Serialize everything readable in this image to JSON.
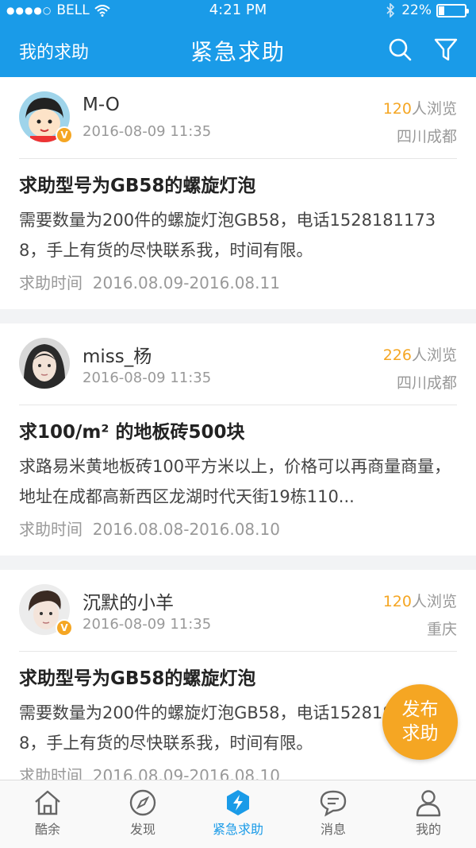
{
  "status": {
    "signal_dots": "●●●●○",
    "carrier": "BELL",
    "time": "4:21 PM",
    "battery": "22%"
  },
  "nav": {
    "left_label": "我的求助",
    "title": "紧急求助",
    "search_icon": "search-icon",
    "filter_icon": "filter-icon"
  },
  "posts": [
    {
      "user": "M-O",
      "time": "2016-08-09  11:35",
      "views_count": "120",
      "views_suffix": "人浏览",
      "location": "四川成都",
      "verified": "V",
      "title": "求助型号为GB58的螺旋灯泡",
      "desc": "需要数量为200件的螺旋灯泡GB58，电话15281811738，手上有货的尽快联系我，时间有限。",
      "help_time_label": "求助时间",
      "help_time": "2016.08.09-2016.08.11"
    },
    {
      "user": "miss_杨",
      "time": "2016-08-09  11:35",
      "views_count": "226",
      "views_suffix": "人浏览",
      "location": "四川成都",
      "verified": "",
      "title": "求100/m² 的地板砖500块",
      "desc": "求路易米黄地板砖100平方米以上，价格可以再商量商量，地址在成都高新西区龙湖时代天街19栋110...",
      "help_time_label": "求助时间",
      "help_time": "2016.08.08-2016.08.10"
    },
    {
      "user": "沉默的小羊",
      "time": "2016-08-09  11:35",
      "views_count": "120",
      "views_suffix": "人浏览",
      "location": "重庆",
      "verified": "V",
      "title": "求助型号为GB58的螺旋灯泡",
      "desc": "需要数量为200件的螺旋灯泡GB58，电话15281811738，手上有货的尽快联系我，时间有限。",
      "help_time_label": "求助时间",
      "help_time": "2016.08.09-2016.08.10"
    }
  ],
  "fab": {
    "line1": "发布",
    "line2": "求助"
  },
  "tabs": [
    {
      "label": "酷余",
      "icon": "home-icon"
    },
    {
      "label": "发现",
      "icon": "compass-icon"
    },
    {
      "label": "紧急求助",
      "icon": "emergency-icon",
      "active": true
    },
    {
      "label": "消息",
      "icon": "message-icon"
    },
    {
      "label": "我的",
      "icon": "profile-icon"
    }
  ],
  "colors": {
    "primary": "#1a9be8",
    "accent": "#f5a623"
  }
}
